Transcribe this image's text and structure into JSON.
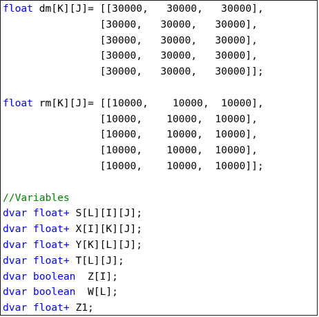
{
  "editor": {
    "colors": {
      "keyword": "#0000ff",
      "comment": "#008000",
      "text": "#000000"
    },
    "lines": [
      {
        "kw": "float",
        "tx": " dm[K][J]= [[30000,   30000,   30000],"
      },
      {
        "tx": "                [30000,   30000,   30000],"
      },
      {
        "tx": "                [30000,   30000,   30000],"
      },
      {
        "tx": "                [30000,   30000,   30000],"
      },
      {
        "tx": "                [30000,   30000,   30000]];"
      },
      {
        "tx": ""
      },
      {
        "kw": "float",
        "tx": " rm[K][J]= [[10000,    10000,  10000],"
      },
      {
        "tx": "                [10000,    10000,  10000],"
      },
      {
        "tx": "                [10000,    10000,  10000],"
      },
      {
        "tx": "                [10000,    10000,  10000],"
      },
      {
        "tx": "                [10000,    10000,  10000]];"
      },
      {
        "tx": ""
      },
      {
        "cm": "//Variables"
      },
      {
        "kw": "dvar float+",
        "tx": " S[L][I][J];"
      },
      {
        "kw": "dvar float+",
        "tx": " X[I][K][J];"
      },
      {
        "kw": "dvar float+",
        "tx": " Y[K][L][J];"
      },
      {
        "kw": "dvar float+",
        "tx": " T[L][J];"
      },
      {
        "kw": "dvar boolean",
        "tx": "  Z[I];"
      },
      {
        "kw": "dvar boolean",
        "tx": "  W[L];"
      },
      {
        "kw": "dvar float+",
        "tx": " Z1;"
      }
    ]
  }
}
